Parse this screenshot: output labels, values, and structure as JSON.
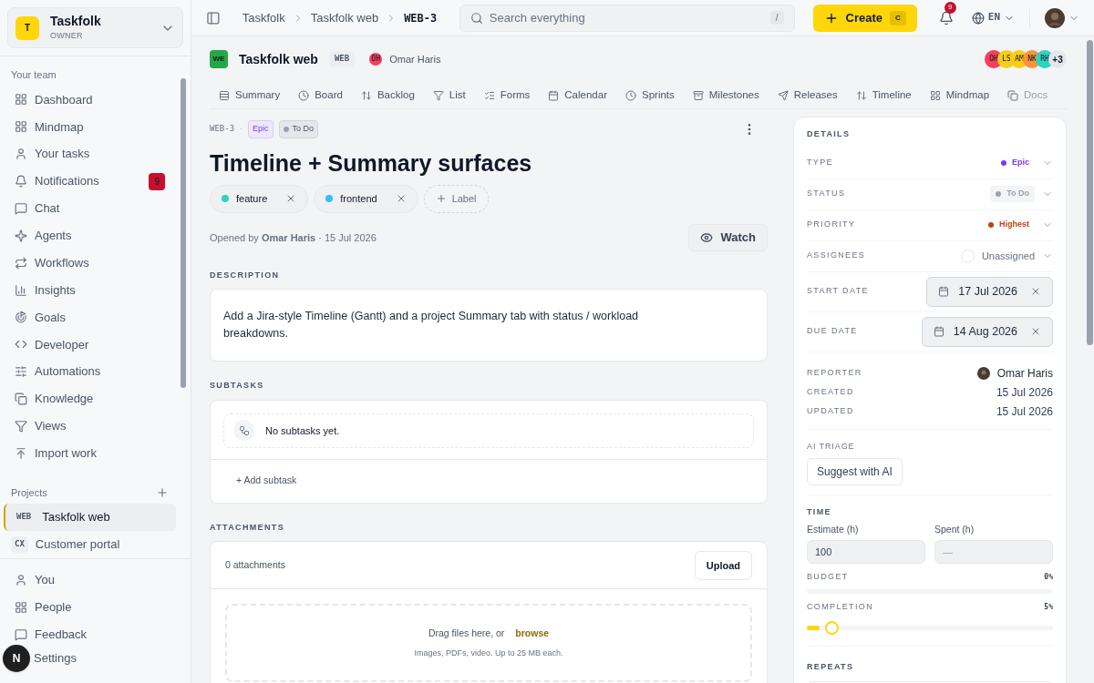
{
  "workspace": {
    "initial": "T",
    "name": "Taskfolk",
    "role": "OWNER"
  },
  "sidebar": {
    "section": "Your team",
    "items": [
      {
        "label": "Dashboard"
      },
      {
        "label": "Mindmap"
      },
      {
        "label": "Your tasks"
      },
      {
        "label": "Notifications",
        "badge": "9"
      },
      {
        "label": "Chat"
      },
      {
        "label": "Agents"
      },
      {
        "label": "Workflows"
      },
      {
        "label": "Insights"
      },
      {
        "label": "Goals"
      },
      {
        "label": "Developer"
      },
      {
        "label": "Automations"
      },
      {
        "label": "Knowledge"
      },
      {
        "label": "Views"
      },
      {
        "label": "Import work"
      }
    ],
    "projects_title": "Projects",
    "projects": [
      {
        "key": "WEB",
        "name": "Taskfolk web",
        "selected": true
      },
      {
        "key": "CX",
        "name": "Customer portal",
        "selected": false
      }
    ],
    "bottom_items": [
      {
        "label": "You"
      },
      {
        "label": "People"
      },
      {
        "label": "Feedback"
      },
      {
        "label": "Settings"
      }
    ],
    "fab": "N"
  },
  "topbar": {
    "breadcrumbs": [
      "Taskfolk",
      "Taskfolk web",
      "WEB-3"
    ],
    "search": {
      "placeholder": "Search everything",
      "shortcut": "/"
    },
    "create": {
      "label": "Create",
      "shortcut": "C"
    },
    "notifications": "9",
    "language": "EN"
  },
  "project": {
    "badge": "WE",
    "name": "Taskfolk web",
    "key": "WEB",
    "owner": {
      "initials": "OH",
      "name": "Omar Haris",
      "color": "#f43f5e"
    },
    "members": [
      {
        "initials": "OH",
        "color": "#f43f5e"
      },
      {
        "initials": "LS",
        "color": "#facc15"
      },
      {
        "initials": "AM",
        "color": "#facc15"
      },
      {
        "initials": "NK",
        "color": "#fb923c"
      },
      {
        "initials": "RH",
        "color": "#2dd4bf"
      }
    ],
    "more": "+3"
  },
  "tabs": [
    {
      "label": "Summary",
      "selected": false
    },
    {
      "label": "Board",
      "selected": false
    },
    {
      "label": "Backlog",
      "selected": false
    },
    {
      "label": "List",
      "selected": false
    },
    {
      "label": "Forms",
      "selected": false
    },
    {
      "label": "Calendar",
      "selected": false
    },
    {
      "label": "Sprints",
      "selected": false
    },
    {
      "label": "Milestones",
      "selected": false
    },
    {
      "label": "Releases",
      "selected": false
    },
    {
      "label": "Timeline",
      "selected": false
    },
    {
      "label": "Mindmap",
      "selected": false
    },
    {
      "label": "Docs",
      "selected": false
    }
  ],
  "issue": {
    "key": "WEB-3",
    "separator": "·",
    "type": "Epic",
    "status": "To Do",
    "title": "Timeline + Summary surfaces",
    "labels": [
      {
        "name": "feature",
        "color": "#2dd4bf"
      },
      {
        "name": "frontend",
        "color": "#38bdf8"
      }
    ],
    "add_label": "Label",
    "opened": "Opened by **Omar Haris** · 15 Jul 2026",
    "watch": "Watch",
    "description_title": "DESCRIPTION",
    "description": "Add a Jira-style Timeline (Gantt) and a project Summary tab with status / workload breakdowns.",
    "subtasks_title": "SUBTASKS",
    "subtasks_empty": "No subtasks yet.",
    "add_subtask": "+ Add subtask",
    "attachments_title": "ATTACHMENTS",
    "attachments_count": "0 attachments",
    "upload": "Upload",
    "drop_text": "Drag files here, or",
    "browse": "browse",
    "drop_hint": "Images, PDFs, video. Up to 25 MB each."
  },
  "details": {
    "title": "DETAILS",
    "fields": [
      {
        "kind": "pill",
        "label": "TYPE",
        "value": "Epic",
        "color": "#7c3aed"
      },
      {
        "kind": "pill",
        "label": "STATUS",
        "value": "To Do",
        "color": "#9ca3af"
      },
      {
        "kind": "pill",
        "label": "PRIORITY",
        "value": "Highest",
        "color": "#c2410c"
      },
      {
        "kind": "assignee",
        "label": "ASSIGNEES",
        "value": "Unassigned"
      },
      {
        "kind": "date",
        "label": "START DATE",
        "value": "17 Jul 2026"
      },
      {
        "kind": "date",
        "label": "DUE DATE",
        "value": "14 Aug 2026"
      }
    ],
    "reporter": {
      "label": "REPORTER",
      "value": "Omar Haris"
    },
    "meta": [
      {
        "label": "CREATED",
        "value": "15 Jul 2026"
      },
      {
        "label": "UPDATED",
        "value": "15 Jul 2026"
      }
    ],
    "ai_title": "AI TRIAGE",
    "ai_button": "Suggest with AI",
    "time_title": "TIME",
    "estimate": {
      "label": "Estimate (h)",
      "value": "100"
    },
    "spent": {
      "label": "Spent (h)",
      "placeholder": "—"
    },
    "budget": {
      "label": "BUDGET",
      "reading": "0%",
      "level": 0
    },
    "completion": {
      "label": "COMPLETION",
      "reading": "5%",
      "level": 0.05
    },
    "repeats_title": "REPEATS"
  }
}
